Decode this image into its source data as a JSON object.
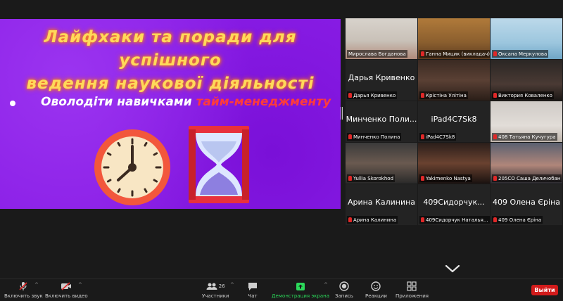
{
  "slide": {
    "title_line1": "Лайфхаки та поради для успішного",
    "title_line2": "ведення наукової діяльності",
    "bullet_prefix": "Оволодіти навичками ",
    "bullet_highlight": "тайм-менеджменту"
  },
  "participants": [
    {
      "name": "Мирослава Богданова",
      "muted": false,
      "display": "video",
      "active": true
    },
    {
      "name": "Ганна Мицик (викладач)",
      "muted": true,
      "display": "video"
    },
    {
      "name": "Оксана Меркулова",
      "muted": true,
      "display": "video"
    },
    {
      "name": "Дарья Кривенко",
      "muted": true,
      "display": "name",
      "bigname": "Дарья Кривенко"
    },
    {
      "name": "Крістіна Улітіна",
      "muted": true,
      "display": "video"
    },
    {
      "name": "Виктория Коваленко",
      "muted": true,
      "display": "video"
    },
    {
      "name": "Минченко Полина",
      "muted": true,
      "display": "name",
      "bigname": "Минченко Поли..."
    },
    {
      "name": "iPad4C7Sk8",
      "muted": true,
      "display": "name",
      "bigname": "iPad4C7Sk8"
    },
    {
      "name": "408 Татьяна Кучугура",
      "muted": true,
      "display": "video"
    },
    {
      "name": "Yullia Skorokhod",
      "muted": true,
      "display": "video"
    },
    {
      "name": "Yakimenko Nastya",
      "muted": true,
      "display": "video"
    },
    {
      "name": "205СО Саша Деличобан",
      "muted": true,
      "display": "video"
    },
    {
      "name": "Арина Калинина",
      "muted": true,
      "display": "name",
      "bigname": "Арина Калинина"
    },
    {
      "name": "409Сидорчук Наталья...",
      "muted": true,
      "display": "name",
      "bigname": "409Сидорчук..."
    },
    {
      "name": "409 Олена Єріна",
      "muted": true,
      "display": "name",
      "bigname": "409 Олена Єріна"
    }
  ],
  "toolbar": {
    "unmute": "Включить звук",
    "start_video": "Включить видео",
    "participants": "Участники",
    "participants_count": "26",
    "chat": "Чат",
    "share": "Демонстрация экрана",
    "record": "Запись",
    "reactions": "Реакции",
    "apps": "Приложения",
    "leave": "Выйти"
  },
  "colors": {
    "accent_green": "#2bd95a",
    "leave_red": "#d21b1b",
    "active_border": "#b4e33d",
    "slide_bg": "#8a1ee6"
  }
}
